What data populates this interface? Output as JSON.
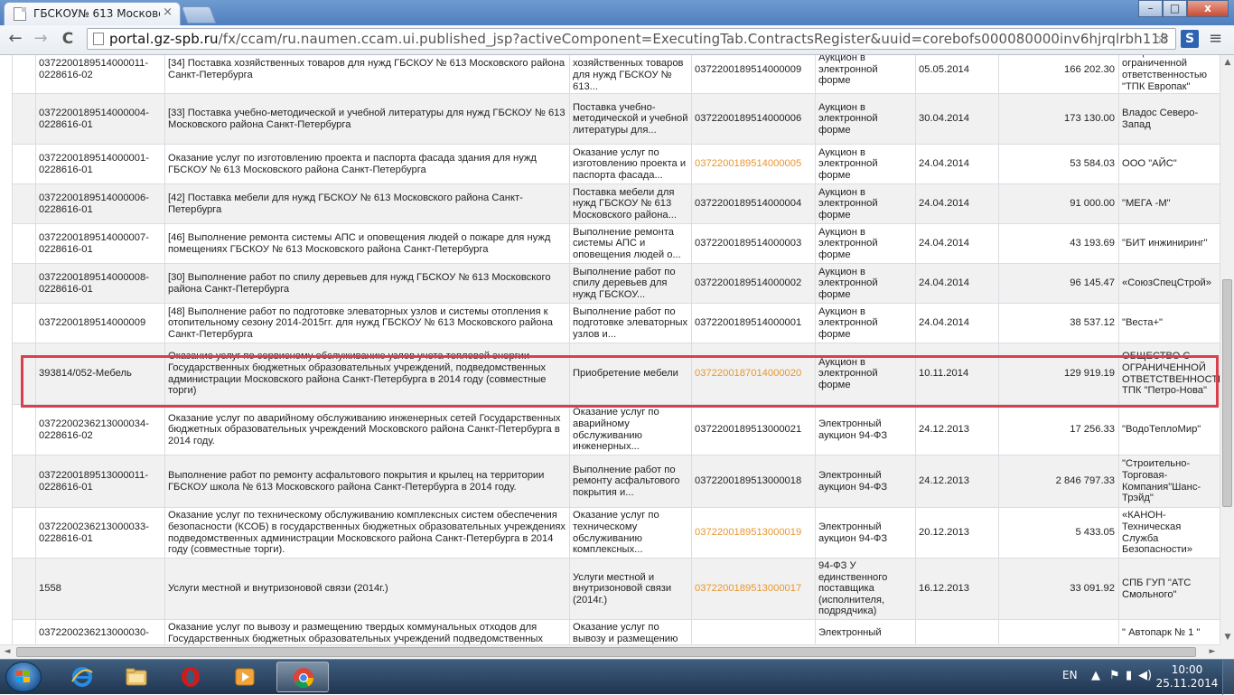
{
  "browser": {
    "tab_title": "ГБСКОУ№ 613 Московск",
    "tab_close": "×",
    "url_host": "portal.gz-spb.ru",
    "url_path": "/fx/ccam/ru.naumen.ccam.ui.published_jsp?activeComponent=ExecutingTab.ContractsRegister&uuid=corebofs000080000inv6hjrqlrbh118",
    "nav": {
      "back": "←",
      "forward": "→",
      "reload": "C"
    },
    "star": "☆",
    "ext_label": "S",
    "menu": "≡",
    "window": {
      "minimize": "–",
      "maximize": "□",
      "close": "x"
    }
  },
  "colors": {
    "link": "#e8962e",
    "highlight": "#d9404d",
    "row_alt": "#f1f1f1"
  },
  "rows": [
    {
      "reg": "0372200189514000011-0228616-02",
      "subject": "[34] Поставка хозяйственных товаров для нужд ГБСКОУ № 613 Московского района Санкт-Петербурга",
      "short": "Поставка хозяйственных товаров для нужд ГБСКОУ № 613...",
      "notice": "0372200189514000009",
      "notice_link": false,
      "method": "Аукцион в электронной форме",
      "date": "05.05.2014",
      "amount": "166 202.30",
      "supplier": "Общество с ограниченной ответственностью \"ТПК Европак\""
    },
    {
      "reg": "0372200189514000004-0228616-01",
      "subject": "[33] Поставка учебно-методической и учебной литературы для нужд ГБСКОУ № 613 Московского района Санкт-Петербурга",
      "short": "Поставка учебно-методической и учебной литературы для...",
      "notice": "0372200189514000006",
      "notice_link": false,
      "method": "Аукцион в электронной форме",
      "date": "30.04.2014",
      "amount": "173 130.00",
      "supplier": "Владос Северо-Запад"
    },
    {
      "reg": "0372200189514000001-0228616-01",
      "subject": "Оказание услуг по изготовлению проекта и паспорта фасада здания для нужд ГБСКОУ № 613 Московского района Санкт-Петербурга",
      "short": "Оказание услуг по изготовлению проекта и паспорта фасада...",
      "notice": "0372200189514000005",
      "notice_link": true,
      "method": "Аукцион в электронной форме",
      "date": "24.04.2014",
      "amount": "53 584.03",
      "supplier": "ООО \"АЙС\""
    },
    {
      "reg": "0372200189514000006-0228616-01",
      "subject": "[42] Поставка мебели для нужд ГБСКОУ № 613 Московского района Санкт-Петербурга",
      "short": "Поставка мебели для нужд ГБСКОУ № 613 Московского района...",
      "notice": "0372200189514000004",
      "notice_link": false,
      "method": "Аукцион в электронной форме",
      "date": "24.04.2014",
      "amount": "91 000.00",
      "supplier": "\"МЕГА -М\""
    },
    {
      "reg": "0372200189514000007-0228616-01",
      "subject": "[46] Выполнение ремонта системы АПС и оповещения людей о пожаре для нужд помещениях ГБСКОУ № 613 Московского района Санкт-Петербурга",
      "short": "Выполнение ремонта системы АПС и оповещения людей о...",
      "notice": "0372200189514000003",
      "notice_link": false,
      "method": "Аукцион в электронной форме",
      "date": "24.04.2014",
      "amount": "43 193.69",
      "supplier": "\"БИТ инжиниринг\""
    },
    {
      "reg": "0372200189514000008-0228616-01",
      "subject": "[30] Выполнение работ по спилу деревьев для нужд ГБСКОУ № 613 Московского района Санкт-Петербурга",
      "short": "Выполнение работ по спилу деревьев для нужд ГБСКОУ...",
      "notice": "0372200189514000002",
      "notice_link": false,
      "method": "Аукцион в электронной форме",
      "date": "24.04.2014",
      "amount": "96 145.47",
      "supplier": "«СоюзСпецСтрой»"
    },
    {
      "reg": "0372200189514000009",
      "subject": "[48] Выполнение работ по подготовке элеваторных узлов и системы отопления к отопительному сезону 2014-2015гг. для нужд ГБСКОУ № 613 Московского района Санкт-Петербурга",
      "short": "Выполнение работ по подготовке элеваторных узлов и...",
      "notice": "0372200189514000001",
      "notice_link": false,
      "method": "Аукцион в электронной форме",
      "date": "24.04.2014",
      "amount": "38 537.12",
      "supplier": "\"Веста+\""
    },
    {
      "reg": "393814/052-Мебель",
      "subject": "Оказание услуг по сервисному обслуживанию узлов учета тепловой энергии Государственных бюджетных образовательных учреждений, подведомственных администрации Московского района Санкт-Петербурга в 2014 году (совместные торги)",
      "short": "Приобретение мебели",
      "notice": "0372200187014000020",
      "notice_link": true,
      "method": "Аукцион в электронной форме",
      "date": "10.11.2014",
      "amount": "129 919.19",
      "supplier": "ОБЩЕСТВО С ОГРАНИЧЕННОЙ ОТВЕТСТВЕННОСТЬЮ ТПК \"Петро-Нова\""
    },
    {
      "reg": "0372200236213000034-0228616-02",
      "subject": "Оказание услуг по аварийному обслуживанию инженерных сетей Государственных бюджетных образовательных учреждений Московского района Санкт-Петербурга в 2014 году.",
      "short": "Оказание услуг по аварийному обслуживанию инженерных...",
      "notice": "0372200189513000021",
      "notice_link": false,
      "method": "Электронный аукцион 94-ФЗ",
      "date": "24.12.2013",
      "amount": "17 256.33",
      "supplier": "\"ВодоТеплоМир\""
    },
    {
      "reg": "0372200189513000011-0228616-01",
      "subject": "Выполнение работ по ремонту асфальтового покрытия и крылец на территории ГБСКОУ школа № 613 Московского района Санкт-Петербурга в 2014 году.",
      "short": "Выполнение работ по ремонту асфальтового покрытия и...",
      "notice": "0372200189513000018",
      "notice_link": false,
      "method": "Электронный аукцион 94-ФЗ",
      "date": "24.12.2013",
      "amount": "2 846 797.33",
      "supplier": "\"Строительно-Торговая-Компания\"Шанс-Трэйд\""
    },
    {
      "reg": "0372200236213000033-0228616-01",
      "subject": "Оказание услуг по техническому обслуживанию комплексных систем обеспечения безопасности (КСОБ) в государственных бюджетных образовательных учреждениях подведомственных администрации Московского района Санкт-Петербурга в 2014 году (совместные торги).",
      "short": "Оказание услуг по техническому обслуживанию комплексных...",
      "notice": "0372200189513000019",
      "notice_link": true,
      "method": "Электронный аукцион 94-ФЗ",
      "date": "20.12.2013",
      "amount": "5 433.05",
      "supplier": "«КАНОН-Техническая Служба Безопасности»"
    },
    {
      "reg": "1558",
      "subject": "Услуги местной и внутризоновой связи (2014г.)",
      "short": "Услуги местной и внутризоновой связи (2014г.)",
      "notice": "0372200189513000017",
      "notice_link": true,
      "method": "94-ФЗ У единственного поставщика (исполнителя, подрядчика)",
      "date": "16.12.2013",
      "amount": "33 091.92",
      "supplier": "СПБ ГУП \"АТС Смольного\""
    },
    {
      "reg": "0372200236213000030-",
      "subject": "Оказание услуг по вывозу и размещению твердых коммунальных отходов для Государственных бюджетных образовательных учреждений подведомственных",
      "short": "Оказание услуг по вывозу и размещению",
      "notice": "",
      "notice_link": false,
      "method": "Электронный",
      "date": "",
      "amount": "",
      "supplier": "\" Автопарк № 1 \""
    }
  ],
  "scrollbar": {
    "up": "▲",
    "down": "▼",
    "left": "◄",
    "right": "►"
  },
  "taskbar": {
    "lang": "EN",
    "time": "10:00",
    "date": "25.11.2014",
    "tray_arrow": "▲",
    "tray_flag": "⚑",
    "tray_network": "▮",
    "tray_volume": "◀)"
  }
}
